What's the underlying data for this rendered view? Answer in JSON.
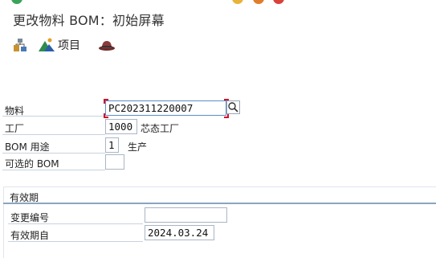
{
  "window": {
    "title": "更改物料 BOM：初始屏幕"
  },
  "toolbar": {
    "items": [
      {
        "icon": "hierarchy-icon"
      },
      {
        "icon": "mountain-icon",
        "label": "项目"
      },
      {
        "icon": "hat-icon"
      }
    ]
  },
  "form": {
    "material": {
      "label": "物料",
      "value": "PC202311220007"
    },
    "plant": {
      "label": "工厂",
      "value": "1000",
      "description": "芯态工厂"
    },
    "bom_usage": {
      "label": "BOM 用途",
      "value": "1",
      "description": "生产"
    },
    "alt_bom": {
      "label": "可选的 BOM",
      "value": ""
    }
  },
  "validity": {
    "title": "有效期",
    "change_number": {
      "label": "变更编号",
      "value": ""
    },
    "valid_from": {
      "label": "有效期自",
      "value": "2024.03.24"
    }
  },
  "colors": {
    "accent": "#5b8fc7",
    "required": "#d0102a",
    "group_line": "#8aa5c0"
  }
}
